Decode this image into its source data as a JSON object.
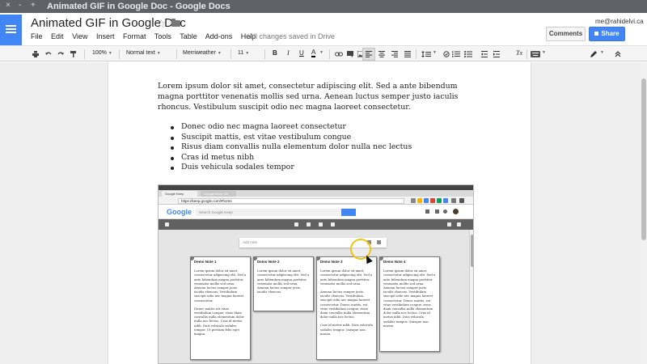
{
  "window": {
    "title": "Animated GIF in Google Doc - Google Docs",
    "controls": [
      "×",
      "-",
      "+"
    ]
  },
  "header": {
    "doc_title": "Animated GIF in Google Doc",
    "user_email": "me@rahidelvi.ca",
    "save_status": "All changes saved in Drive",
    "comments_label": "Comments",
    "share_label": "Share",
    "star_glyph": "☆",
    "menu": [
      "File",
      "Edit",
      "View",
      "Insert",
      "Format",
      "Tools",
      "Table",
      "Add-ons",
      "Help"
    ]
  },
  "toolbar": {
    "zoom": "100%",
    "style": "Normal text",
    "font": "Merriweather",
    "size": "11",
    "bold": "B",
    "italic": "I",
    "underline": "U",
    "text_color": "A",
    "clear_format": "Tx",
    "icons": [
      "print-icon",
      "undo-icon",
      "redo-icon",
      "paint-format-icon",
      "link-icon",
      "comment-icon",
      "image-icon",
      "align-left-icon",
      "align-center-icon",
      "align-right-icon",
      "align-justify-icon",
      "line-spacing-icon",
      "checklist-icon",
      "numbered-list-icon",
      "bulleted-list-icon",
      "decrease-indent-icon",
      "increase-indent-icon",
      "clear-formatting-icon",
      "input-tools-icon",
      "pen-icon",
      "collapse-icon"
    ]
  },
  "document": {
    "paragraph": "Lorem ipsum dolor sit amet, consectetur adipiscing elit. Sed a ante bibendum magna porttitor venenatis mollis sed urna. Aenean luctus semper justo iaculis rhoncus. Vestibulum suscipit odio nec magna laoreet consectetur.",
    "bullets": [
      "Donec odio nec magna laoreet consectetur",
      "Suscipit mattis, est vitae vestibulum congue",
      "Risus diam convallis nulla elementum dolor nulla nec lectus",
      "Cras id metus nibh",
      "Duis vehicula sodales tempor"
    ]
  },
  "gif": {
    "tabs": [
      "Google Keep",
      "Google Keep Ext"
    ],
    "url": "https://keep.google.com/#home",
    "logo": "Google",
    "search_placeholder": "Search Google Keep",
    "add_note_placeholder": "Add note",
    "notes": [
      {
        "title": "Demo Note 1",
        "paragraphs": [
          "Lorem ipsum dolor sit amet, consectetur adipiscing elit. Sed a ante bibendum magna porttitor venenatis mollis sed urna. Aenean luctus semper justo iaculis rhoncus. Vestibulum suscipit odio nec magna laoreet consectetur.",
          "Donec mattis est vitae vestibulum congue, risus diam convallis nulla elementum dolor nulla nec lectus. Cras id metus nibh. Duis vehicula sodales tempor. Ut pretium felis eget magna."
        ]
      },
      {
        "title": "Demo Note 2",
        "paragraphs": [
          "Lorem ipsum dolor sit amet, consectetur adipiscing elit. Sed a ante bibendum magna porttitor venenatis mollis sed urna. Aenean luctus semper justo iaculis rhoncus."
        ]
      },
      {
        "title": "Demo Note 3",
        "paragraphs": [
          "Lorem ipsum dolor sit amet, consectetur adipiscing elit. Sed a ante bibendum magna porttitor venenatis mollis sed urna.",
          "Aenean luctus semper justo iaculis rhoncus. Vestibulum suscipit odio nec magna laoreet consectetur. Donec mattis, est vitae vestibulum congue, risus diam convallis nulla elementum dolor nulla nec lectus.",
          "Cras id metus nibh. Duis vehicula sodales tempor. Quisque non massa."
        ]
      },
      {
        "title": "Demo Note 4",
        "paragraphs": [
          "Lorem ipsum dolor sit amet, consectetur adipiscing elit. Sed a ante bibendum magna porttitor venenatis mollis sed urna. Aenean luctus semper justo iaculis rhoncus. Vestibulum suscipit odio nec magna laoreet consectetur. Donec mattis, est vitae vestibulum congue, risus diam convallis nulla elementum dolor nulla nec lectus. Cras id metus nibh. Duis vehicula sodales tempor. Quisque non massa."
        ]
      }
    ]
  },
  "colors": {
    "accent": "#4285f4",
    "titlebar": "#5f6368",
    "cursor_ring": "#f1c40f"
  }
}
